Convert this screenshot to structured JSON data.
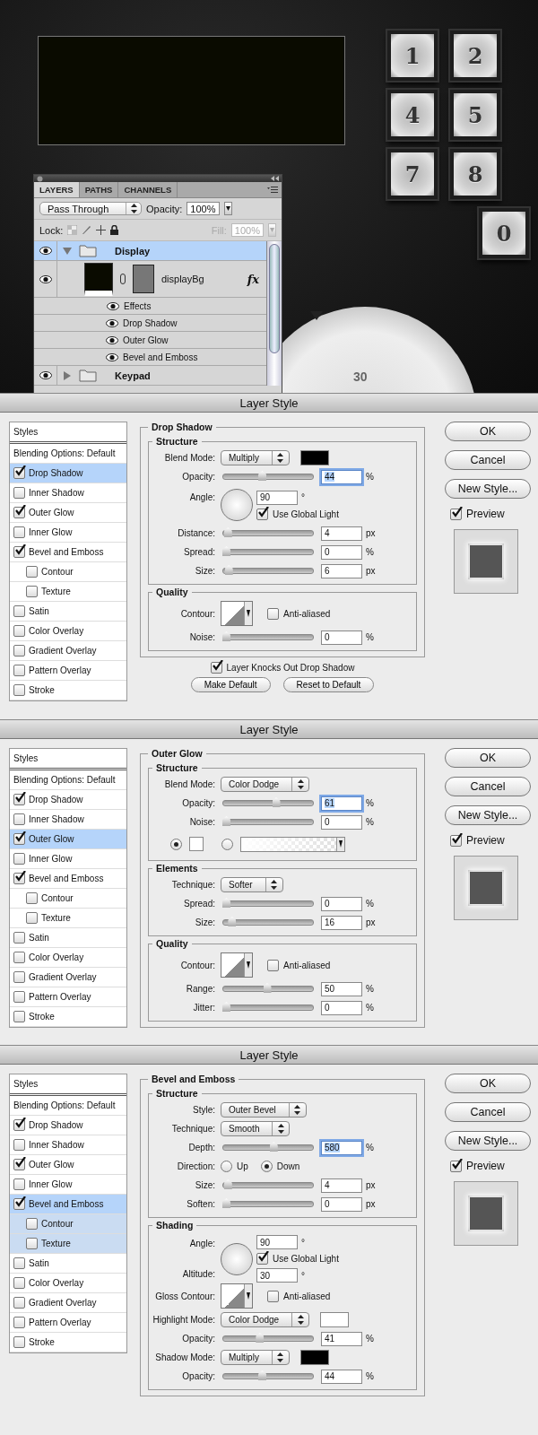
{
  "scene": {
    "keypad_rows": [
      [
        "1",
        "2"
      ],
      [
        "4",
        "5"
      ],
      [
        "7",
        "8"
      ],
      [
        "0"
      ]
    ],
    "dial_label": "30"
  },
  "layers_panel": {
    "tabs": [
      {
        "label": "LAYERS",
        "selected": true
      },
      {
        "label": "PATHS",
        "selected": false
      },
      {
        "label": "CHANNELS",
        "selected": false
      }
    ],
    "blend_mode": "Pass Through",
    "opacity_label": "Opacity:",
    "opacity": "100%",
    "lock_label": "Lock:",
    "fill_label": "Fill:",
    "fill": "100%",
    "layers": [
      {
        "kind": "group",
        "name": "Display",
        "visible": true,
        "expanded": true,
        "selected": true,
        "children": [
          {
            "kind": "layer",
            "name": "displayBg",
            "visible": true,
            "selected": false,
            "fx": "fx",
            "effects_label": "Effects",
            "effects": [
              {
                "name": "Drop Shadow",
                "visible": true
              },
              {
                "name": "Outer Glow",
                "visible": true
              },
              {
                "name": "Bevel and Emboss",
                "visible": true
              }
            ]
          }
        ]
      },
      {
        "kind": "group",
        "name": "Keypad",
        "visible": true,
        "expanded": false,
        "selected": false
      }
    ]
  },
  "dialogs": [
    {
      "title": "Layer Style",
      "styles": [
        {
          "kind": "header",
          "label": "Styles"
        },
        {
          "kind": "header",
          "label": "Blending Options: Default",
          "selected": false
        },
        {
          "kind": "check",
          "label": "Drop Shadow",
          "checked": true,
          "selected": true
        },
        {
          "kind": "check",
          "label": "Inner Shadow",
          "checked": false,
          "selected": false
        },
        {
          "kind": "check",
          "label": "Outer Glow",
          "checked": true,
          "selected": false
        },
        {
          "kind": "check",
          "label": "Inner Glow",
          "checked": false,
          "selected": false
        },
        {
          "kind": "check",
          "label": "Bevel and Emboss",
          "checked": true,
          "selected": false,
          "children": [
            {
              "label": "Contour",
              "checked": false,
              "selected": false
            },
            {
              "label": "Texture",
              "checked": false,
              "selected": false
            }
          ]
        },
        {
          "kind": "check",
          "label": "Satin",
          "checked": false,
          "selected": false
        },
        {
          "kind": "check",
          "label": "Color Overlay",
          "checked": false,
          "selected": false
        },
        {
          "kind": "check",
          "label": "Gradient Overlay",
          "checked": false,
          "selected": false
        },
        {
          "kind": "check",
          "label": "Pattern Overlay",
          "checked": false,
          "selected": false
        },
        {
          "kind": "check",
          "label": "Stroke",
          "checked": false,
          "selected": false
        }
      ],
      "section": "Drop Shadow",
      "groups": [
        {
          "title": "Structure",
          "rows": [
            {
              "kind": "select",
              "label": "Blend Mode:",
              "value": "Multiply",
              "color": "#000000"
            },
            {
              "kind": "slider",
              "label": "Opacity:",
              "level": 0.44,
              "value": "44",
              "unit": "%",
              "highlighted": true
            },
            {
              "kind": "angle",
              "label": "Angle:",
              "value": "90",
              "unit": "°",
              "checkbox": {
                "label": "Use Global Light",
                "checked": true
              }
            },
            {
              "kind": "slider",
              "label": "Distance:",
              "level": 0.02,
              "value": "4",
              "unit": "px",
              "highlighted": false
            },
            {
              "kind": "slider",
              "label": "Spread:",
              "level": 0,
              "value": "0",
              "unit": "%",
              "highlighted": false
            },
            {
              "kind": "slider",
              "label": "Size:",
              "level": 0.03,
              "value": "6",
              "unit": "px",
              "highlighted": false
            }
          ]
        },
        {
          "title": "Quality",
          "rows": [
            {
              "kind": "contour",
              "label": "Contour:",
              "checkbox": {
                "label": "Anti-aliased",
                "checked": false
              }
            },
            {
              "kind": "slider",
              "label": "Noise:",
              "level": 0,
              "value": "0",
              "unit": "%",
              "highlighted": false
            }
          ]
        }
      ],
      "footer": {
        "checkbox": {
          "label": "Layer Knocks Out Drop Shadow",
          "checked": true
        },
        "buttons": [
          "Make Default",
          "Reset to Default"
        ]
      },
      "buttons": [
        "OK",
        "Cancel",
        "New Style..."
      ],
      "preview": {
        "label": "Preview",
        "checked": true
      }
    },
    {
      "title": "Layer Style",
      "styles": [
        {
          "kind": "header",
          "label": "Styles"
        },
        {
          "kind": "header",
          "label": "Blending Options: Default",
          "selected": false
        },
        {
          "kind": "check",
          "label": "Drop Shadow",
          "checked": true,
          "selected": false
        },
        {
          "kind": "check",
          "label": "Inner Shadow",
          "checked": false,
          "selected": false
        },
        {
          "kind": "check",
          "label": "Outer Glow",
          "checked": true,
          "selected": true
        },
        {
          "kind": "check",
          "label": "Inner Glow",
          "checked": false,
          "selected": false
        },
        {
          "kind": "check",
          "label": "Bevel and Emboss",
          "checked": true,
          "selected": false,
          "children": [
            {
              "label": "Contour",
              "checked": false,
              "selected": false
            },
            {
              "label": "Texture",
              "checked": false,
              "selected": false
            }
          ]
        },
        {
          "kind": "check",
          "label": "Satin",
          "checked": false,
          "selected": false
        },
        {
          "kind": "check",
          "label": "Color Overlay",
          "checked": false,
          "selected": false
        },
        {
          "kind": "check",
          "label": "Gradient Overlay",
          "checked": false,
          "selected": false
        },
        {
          "kind": "check",
          "label": "Pattern Overlay",
          "checked": false,
          "selected": false
        },
        {
          "kind": "check",
          "label": "Stroke",
          "checked": false,
          "selected": false
        }
      ],
      "section": "Outer Glow",
      "groups": [
        {
          "title": "Structure",
          "rows": [
            {
              "kind": "select",
              "label": "Blend Mode:",
              "value": "Color Dodge"
            },
            {
              "kind": "slider",
              "label": "Opacity:",
              "level": 0.61,
              "value": "61",
              "unit": "%",
              "highlighted": true
            },
            {
              "kind": "slider",
              "label": "Noise:",
              "level": 0,
              "value": "0",
              "unit": "%",
              "highlighted": false
            },
            {
              "kind": "glow_source",
              "options": [
                {
                  "kind": "color",
                  "selected": true,
                  "color": "#ffffff"
                },
                {
                  "kind": "gradient",
                  "selected": false
                }
              ]
            }
          ]
        },
        {
          "title": "Elements",
          "rows": [
            {
              "kind": "select",
              "label": "Technique:",
              "value": "Softer"
            },
            {
              "kind": "slider",
              "label": "Spread:",
              "level": 0,
              "value": "0",
              "unit": "%",
              "highlighted": false
            },
            {
              "kind": "slider",
              "label": "Size:",
              "level": 0.07,
              "value": "16",
              "unit": "px",
              "highlighted": false
            }
          ]
        },
        {
          "title": "Quality",
          "rows": [
            {
              "kind": "contour",
              "label": "Contour:",
              "checkbox": {
                "label": "Anti-aliased",
                "checked": false
              }
            },
            {
              "kind": "slider",
              "label": "Range:",
              "level": 0.5,
              "value": "50",
              "unit": "%",
              "highlighted": false
            },
            {
              "kind": "slider",
              "label": "Jitter:",
              "level": 0,
              "value": "0",
              "unit": "%",
              "highlighted": false
            }
          ]
        }
      ],
      "buttons": [
        "OK",
        "Cancel",
        "New Style..."
      ],
      "preview": {
        "label": "Preview",
        "checked": true
      }
    },
    {
      "title": "Layer Style",
      "styles": [
        {
          "kind": "header",
          "label": "Styles"
        },
        {
          "kind": "header",
          "label": "Blending Options: Default",
          "selected": false
        },
        {
          "kind": "check",
          "label": "Drop Shadow",
          "checked": true,
          "selected": false
        },
        {
          "kind": "check",
          "label": "Inner Shadow",
          "checked": false,
          "selected": false
        },
        {
          "kind": "check",
          "label": "Outer Glow",
          "checked": true,
          "selected": false
        },
        {
          "kind": "check",
          "label": "Inner Glow",
          "checked": false,
          "selected": false
        },
        {
          "kind": "check",
          "label": "Bevel and Emboss",
          "checked": true,
          "selected": true,
          "children": [
            {
              "label": "Contour",
              "checked": false,
              "selected": true
            },
            {
              "label": "Texture",
              "checked": false,
              "selected": true
            }
          ]
        },
        {
          "kind": "check",
          "label": "Satin",
          "checked": false,
          "selected": false
        },
        {
          "kind": "check",
          "label": "Color Overlay",
          "checked": false,
          "selected": false
        },
        {
          "kind": "check",
          "label": "Gradient Overlay",
          "checked": false,
          "selected": false
        },
        {
          "kind": "check",
          "label": "Pattern Overlay",
          "checked": false,
          "selected": false
        },
        {
          "kind": "check",
          "label": "Stroke",
          "checked": false,
          "selected": false
        }
      ],
      "section": "Bevel and Emboss",
      "groups": [
        {
          "title": "Structure",
          "rows": [
            {
              "kind": "select",
              "label": "Style:",
              "value": "Outer Bevel"
            },
            {
              "kind": "select",
              "label": "Technique:",
              "value": "Smooth"
            },
            {
              "kind": "slider",
              "label": "Depth:",
              "level": 0.58,
              "value": "580",
              "unit": "%",
              "highlighted": true
            },
            {
              "kind": "radio",
              "label": "Direction:",
              "options": [
                {
                  "label": "Up",
                  "selected": false
                },
                {
                  "label": "Down",
                  "selected": true
                }
              ]
            },
            {
              "kind": "slider",
              "label": "Size:",
              "level": 0.02,
              "value": "4",
              "unit": "px",
              "highlighted": false
            },
            {
              "kind": "slider",
              "label": "Soften:",
              "level": 0,
              "value": "0",
              "unit": "px",
              "highlighted": false
            }
          ]
        },
        {
          "title": "Shading",
          "rows": [
            {
              "kind": "angle",
              "label": "Angle:",
              "value": "90",
              "unit": "°",
              "checkbox": {
                "label": "Use Global Light",
                "checked": true
              },
              "altitude_label": "Altitude:",
              "altitude_value": "30",
              "altitude_unit": "°"
            },
            {
              "kind": "contour",
              "label": "Gloss Contour:",
              "checkbox": {
                "label": "Anti-aliased",
                "checked": false
              }
            },
            {
              "kind": "select",
              "label": "Highlight Mode:",
              "value": "Color Dodge",
              "color": "#ffffff"
            },
            {
              "kind": "slider",
              "label": "Opacity:",
              "level": 0.41,
              "value": "41",
              "unit": "%",
              "highlighted": false
            },
            {
              "kind": "select",
              "label": "Shadow Mode:",
              "value": "Multiply",
              "color": "#000000"
            },
            {
              "kind": "slider",
              "label": "Opacity:",
              "level": 0.44,
              "value": "44",
              "unit": "%",
              "highlighted": false
            }
          ]
        }
      ],
      "buttons": [
        "OK",
        "Cancel",
        "New Style..."
      ],
      "preview": {
        "label": "Preview",
        "checked": true
      }
    }
  ]
}
